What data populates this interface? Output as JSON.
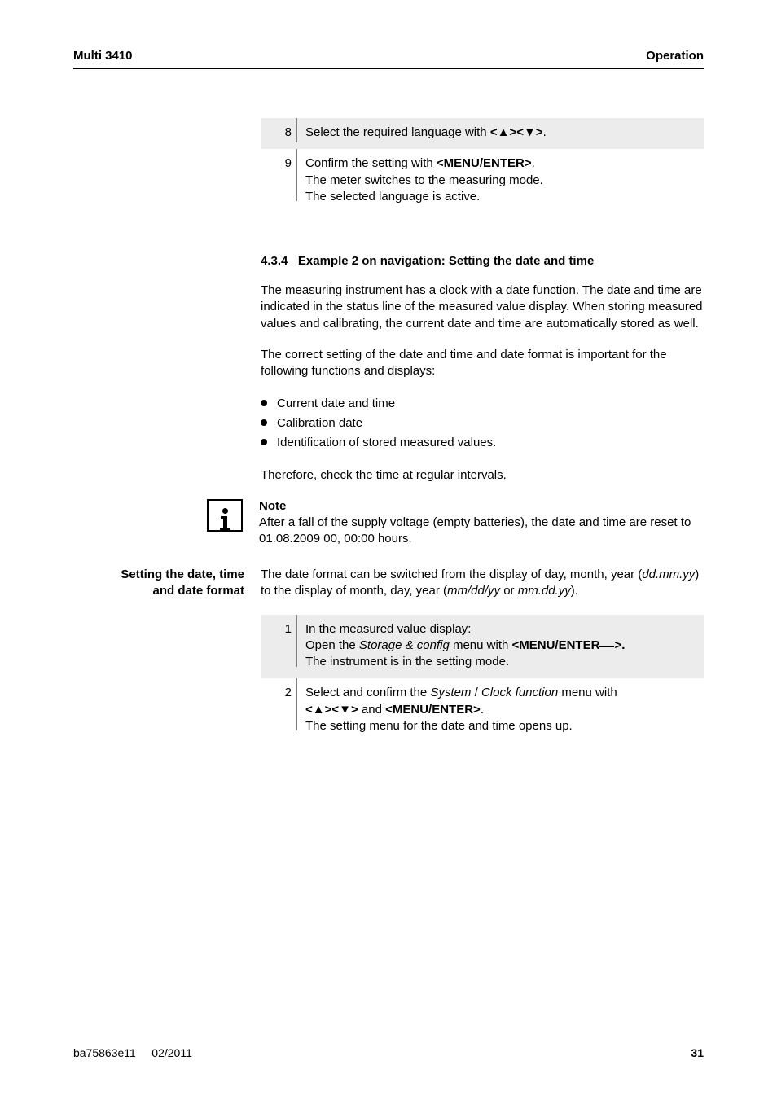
{
  "header": {
    "left": "Multi 3410",
    "right": "Operation"
  },
  "steps_top": [
    {
      "n": "8",
      "text_pre": "Select the required language with ",
      "key": "<▲><▼>",
      "text_post": "."
    },
    {
      "n": "9",
      "line1_pre": "Confirm the setting with ",
      "line1_key": "<MENU/ENTER>",
      "line1_post": ".",
      "line2": "The meter switches to the measuring mode.",
      "line3": "The selected language is active."
    }
  ],
  "section": {
    "number": "4.3.4",
    "title": "Example 2 on navigation: Setting the date and time"
  },
  "paras": {
    "p1": "The measuring instrument has a clock with a date function. The date and time are indicated in the status line of the measured value display. When storing measured values and calibrating, the current date and time are automatically stored as well.",
    "p2": "The correct setting of the date and time and date format is important for the following functions and displays:",
    "bullets": [
      "Current date and time",
      "Calibration date",
      "Identification of stored measured values."
    ],
    "p3": "Therefore, check the time at regular intervals.",
    "note_label": "Note",
    "note_text": "After a fall of the supply voltage (empty batteries), the date and time are reset to 01.08.2009 00, 00:00 hours."
  },
  "side_heading": {
    "line1": "Setting the date, time",
    "line2": "and date format"
  },
  "date_para_pre": "The date format can be switched from the display of day, month, year (",
  "date_para_it1": "dd.mm.yy",
  "date_para_mid": ") to the display of month, day, year (",
  "date_para_it2": "mm/dd/yy",
  "date_para_or": " or ",
  "date_para_it3": "mm.dd.yy",
  "date_para_post": ").",
  "steps_bottom": [
    {
      "n": "1",
      "l1": "In the measured value display:",
      "l2_pre": "Open the ",
      "l2_it": "Storage & config",
      "l2_mid": " menu with ",
      "l2_key": "<MENU/ENTER",
      "l2_post": ">.",
      "l3": "The instrument is in the setting mode."
    },
    {
      "n": "2",
      "l1_pre": "Select and confirm the ",
      "l1_it1": "System",
      "l1_slash": " / ",
      "l1_it2": "Clock function",
      "l1_post": " menu with",
      "l2_k1": "<▲><▼>",
      "l2_and": " and ",
      "l2_k2": "<MENU/ENTER>",
      "l2_dot": ".",
      "l3": "The setting menu for the date and time opens up."
    }
  ],
  "footer": {
    "left1": "ba75863e11",
    "left2": "02/2011",
    "right": "31"
  }
}
